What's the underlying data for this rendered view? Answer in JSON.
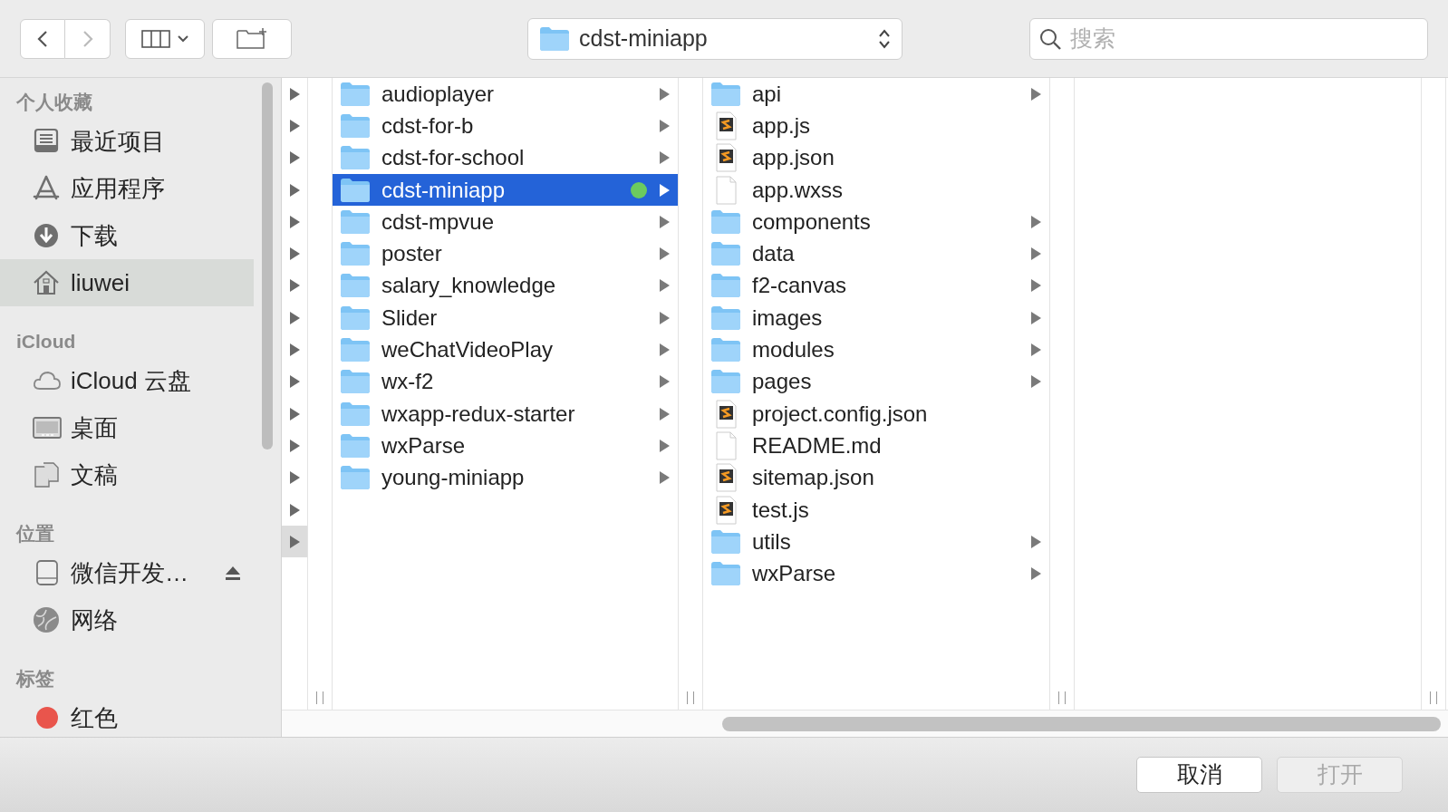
{
  "toolbar": {
    "back": {
      "disabled": false
    },
    "forward": {
      "disabled": true
    },
    "path": "cdst-miniapp",
    "search": {
      "placeholder": "搜索"
    }
  },
  "sidebar": {
    "sections": [
      {
        "heading": "个人收藏",
        "items": [
          {
            "kind": "recents",
            "label": "最近项目",
            "selected": false
          },
          {
            "kind": "apps",
            "label": "应用程序",
            "selected": false
          },
          {
            "kind": "download",
            "label": "下载",
            "selected": false
          },
          {
            "kind": "home",
            "label": "liuwei",
            "selected": true
          }
        ]
      },
      {
        "heading": "iCloud",
        "items": [
          {
            "kind": "cloud",
            "label": "iCloud 云盘",
            "selected": false
          },
          {
            "kind": "desktop",
            "label": "桌面",
            "selected": false
          },
          {
            "kind": "documents",
            "label": "文稿",
            "selected": false
          }
        ]
      },
      {
        "heading": "位置",
        "items": [
          {
            "kind": "drive",
            "label": "微信开发…",
            "selected": false,
            "ejectable": true
          },
          {
            "kind": "network",
            "label": "网络",
            "selected": false
          }
        ]
      },
      {
        "heading": "标签",
        "items": [
          {
            "kind": "tag",
            "label": "红色",
            "selected": false,
            "color": "#e9554c"
          }
        ]
      }
    ]
  },
  "columns": [
    {
      "rows": [
        {
          "selected": false
        },
        {
          "selected": false
        },
        {
          "selected": false
        },
        {
          "selected": false
        },
        {
          "selected": false
        },
        {
          "selected": false
        },
        {
          "selected": false
        },
        {
          "selected": false
        },
        {
          "selected": false
        },
        {
          "selected": false
        },
        {
          "selected": false
        },
        {
          "selected": false
        },
        {
          "selected": false
        },
        {
          "selected": false
        },
        {
          "selected": true
        }
      ]
    },
    {
      "rows": [
        {
          "kind": "folder",
          "name": "audioplayer",
          "selected": false
        },
        {
          "kind": "folder",
          "name": "cdst-for-b",
          "selected": false
        },
        {
          "kind": "folder",
          "name": "cdst-for-school",
          "selected": false
        },
        {
          "kind": "folder",
          "name": "cdst-miniapp",
          "selected": true,
          "color": "#6ccb5f"
        },
        {
          "kind": "folder",
          "name": "cdst-mpvue",
          "selected": false
        },
        {
          "kind": "folder",
          "name": "poster",
          "selected": false
        },
        {
          "kind": "folder",
          "name": "salary_knowledge",
          "selected": false
        },
        {
          "kind": "folder",
          "name": "Slider",
          "selected": false
        },
        {
          "kind": "folder",
          "name": "weChatVideoPlay",
          "selected": false
        },
        {
          "kind": "folder",
          "name": "wx-f2",
          "selected": false
        },
        {
          "kind": "folder",
          "name": "wxapp-redux-starter",
          "selected": false
        },
        {
          "kind": "folder",
          "name": "wxParse",
          "selected": false
        },
        {
          "kind": "folder",
          "name": "young-miniapp",
          "selected": false
        }
      ]
    },
    {
      "rows": [
        {
          "kind": "folder",
          "name": "api",
          "selected": false
        },
        {
          "kind": "script",
          "name": "app.js",
          "selected": false
        },
        {
          "kind": "script",
          "name": "app.json",
          "selected": false
        },
        {
          "kind": "file",
          "name": "app.wxss",
          "selected": false
        },
        {
          "kind": "folder",
          "name": "components",
          "selected": false
        },
        {
          "kind": "folder",
          "name": "data",
          "selected": false
        },
        {
          "kind": "folder",
          "name": "f2-canvas",
          "selected": false
        },
        {
          "kind": "folder",
          "name": "images",
          "selected": false
        },
        {
          "kind": "folder",
          "name": "modules",
          "selected": false
        },
        {
          "kind": "folder",
          "name": "pages",
          "selected": false
        },
        {
          "kind": "script",
          "name": "project.config.json",
          "selected": false
        },
        {
          "kind": "file",
          "name": "README.md",
          "selected": false
        },
        {
          "kind": "script",
          "name": "sitemap.json",
          "selected": false
        },
        {
          "kind": "script",
          "name": "test.js",
          "selected": false
        },
        {
          "kind": "folder",
          "name": "utils",
          "selected": false
        },
        {
          "kind": "folder",
          "name": "wxParse",
          "selected": false
        }
      ]
    },
    {}
  ],
  "buttons": [
    {
      "label": "取消",
      "disabled": false
    },
    {
      "label": "打开",
      "disabled": true
    }
  ]
}
